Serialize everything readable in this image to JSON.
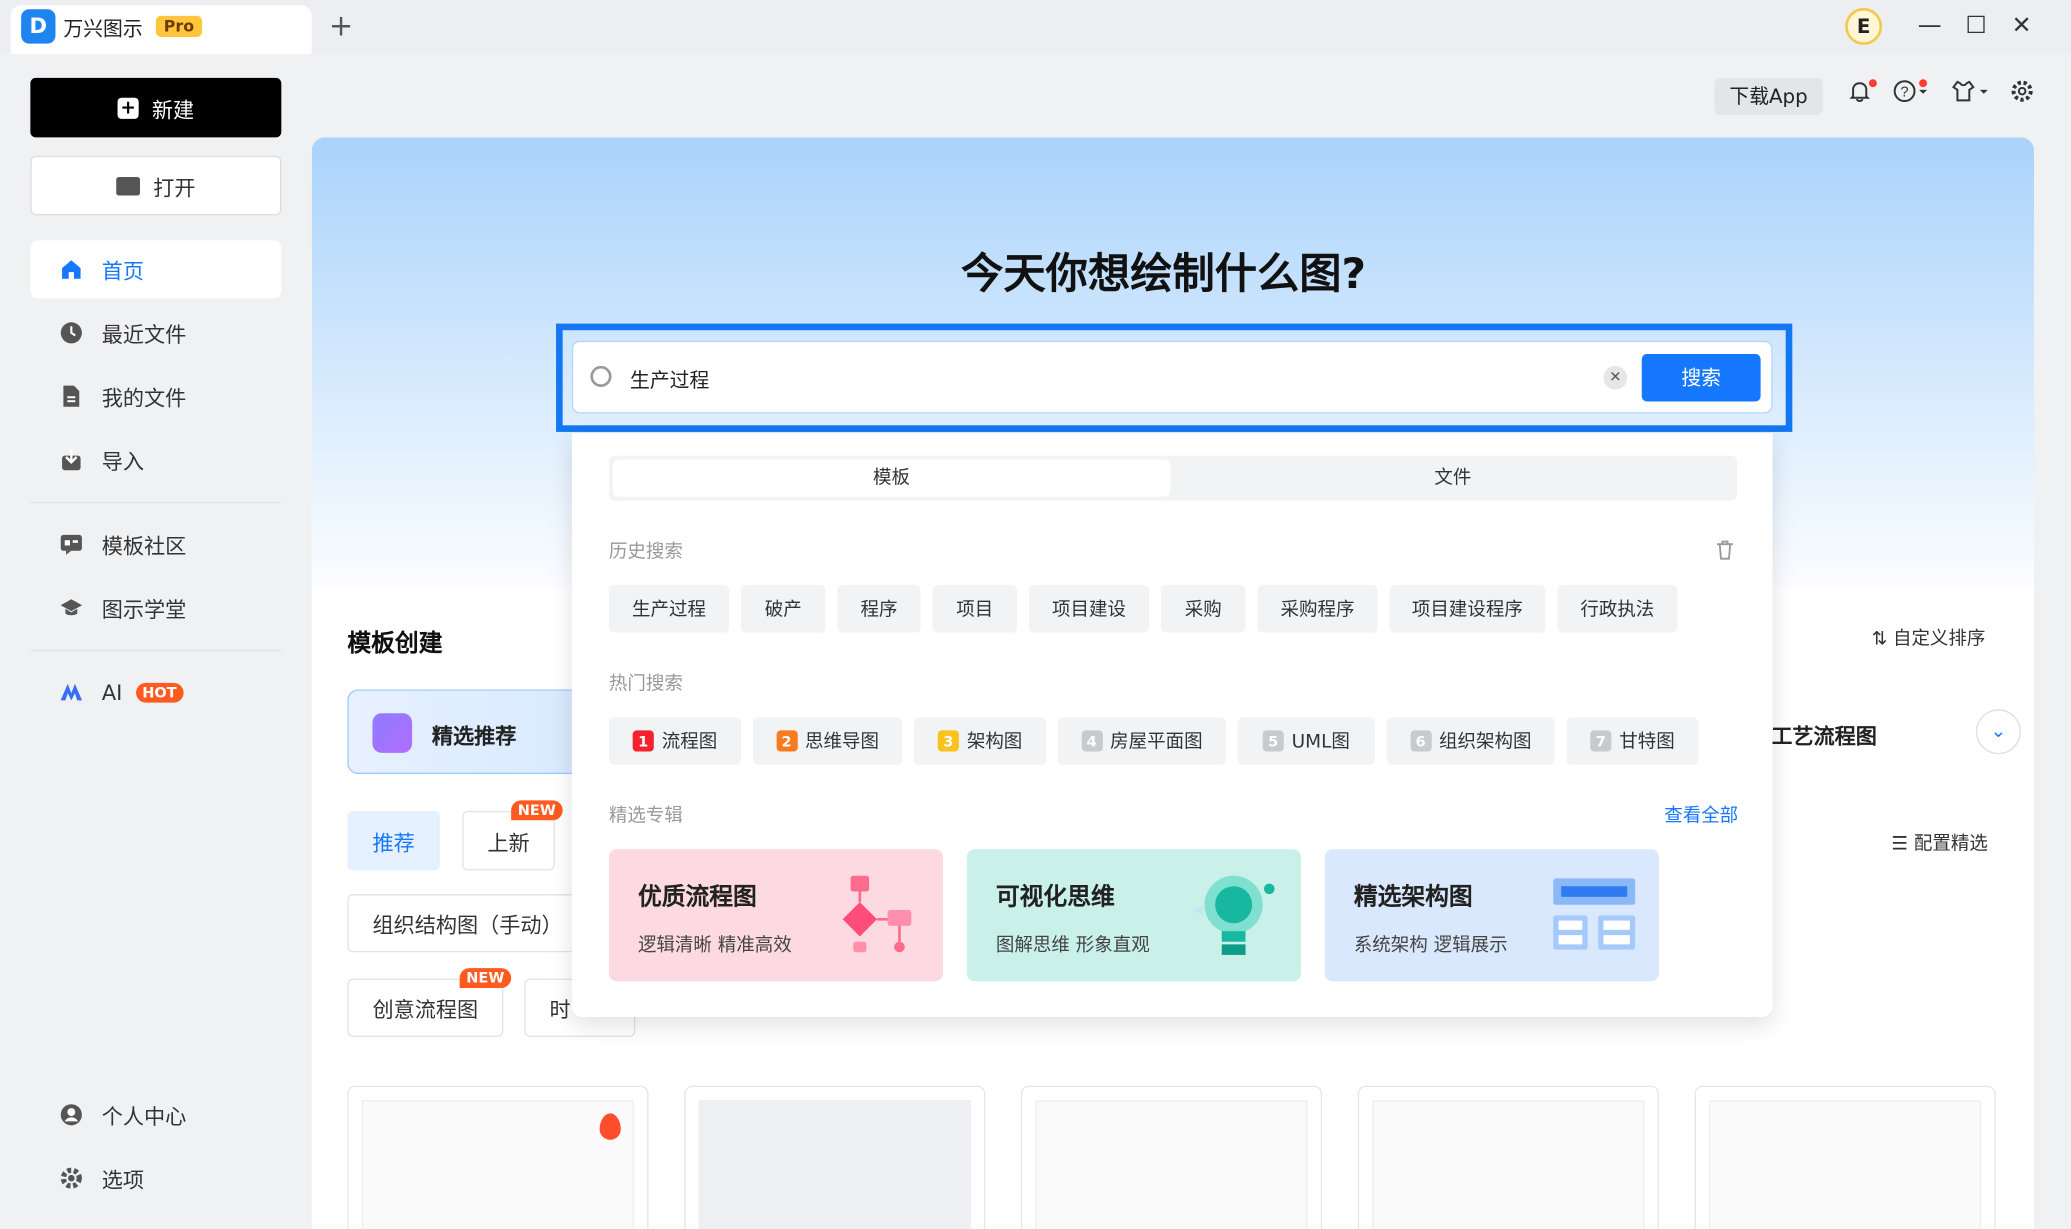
{
  "app": {
    "name": "万兴图示",
    "badge": "Pro",
    "logo_letter": "D",
    "user_initial": "E"
  },
  "sidebar": {
    "new_label": "新建",
    "open_label": "打开",
    "items": [
      {
        "label": "首页",
        "icon": "home-icon"
      },
      {
        "label": "最近文件",
        "icon": "clock-icon"
      },
      {
        "label": "我的文件",
        "icon": "file-icon"
      },
      {
        "label": "导入",
        "icon": "import-icon"
      },
      {
        "label": "模板社区",
        "icon": "community-icon"
      },
      {
        "label": "图示学堂",
        "icon": "graduation-cap-icon"
      },
      {
        "label": "AI",
        "icon": "ai-icon",
        "badge": "HOT"
      }
    ],
    "bottom": [
      {
        "label": "个人中心",
        "icon": "user-icon"
      },
      {
        "label": "选项",
        "icon": "gear-icon"
      }
    ]
  },
  "toolbar": {
    "download": "下载App"
  },
  "hero": {
    "title": "今天你想绘制什么图?"
  },
  "search": {
    "value": "生产过程",
    "button": "搜索"
  },
  "dropdown": {
    "tabs": [
      "模板",
      "文件"
    ],
    "history_label": "历史搜索",
    "history": [
      "生产过程",
      "破产",
      "程序",
      "项目",
      "项目建设",
      "采购",
      "采购程序",
      "项目建设程序",
      "行政执法"
    ],
    "hot_label": "热门搜索",
    "hot": [
      {
        "rank": "1",
        "label": "流程图"
      },
      {
        "rank": "2",
        "label": "思维导图"
      },
      {
        "rank": "3",
        "label": "架构图"
      },
      {
        "rank": "4",
        "label": "房屋平面图"
      },
      {
        "rank": "5",
        "label": "UML图"
      },
      {
        "rank": "6",
        "label": "组织架构图"
      },
      {
        "rank": "7",
        "label": "甘特图"
      }
    ],
    "featured_label": "精选专辑",
    "view_all": "查看全部",
    "featured": [
      {
        "title": "优质流程图",
        "sub": "逻辑清晰 精准高效"
      },
      {
        "title": "可视化思维",
        "sub": "图解思维 形象直观"
      },
      {
        "title": "精选架构图",
        "sub": "系统架构 逻辑展示"
      }
    ]
  },
  "templates": {
    "title": "模板创建",
    "sort": "自定义排序",
    "category": "精选推荐",
    "category_right": "工艺流程图",
    "filters": [
      "推荐",
      "上新"
    ],
    "new_badge": "NEW",
    "pill_org": "组织结构图（手动）",
    "pill_creative": "创意流程图",
    "pill_partial": "时",
    "config": "配置精选"
  },
  "colors": {
    "accent": "#1677ff",
    "search_outline": "#1377f1"
  }
}
